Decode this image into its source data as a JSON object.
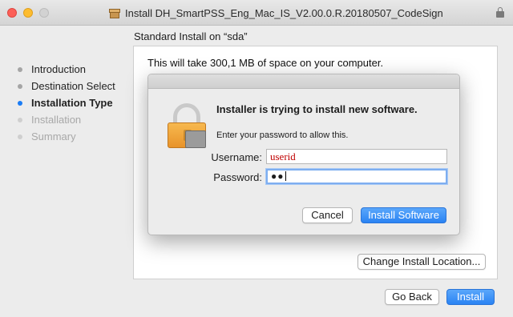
{
  "window": {
    "title": "Install DH_SmartPSS_Eng_Mac_IS_V2.00.0.R.20180507_CodeSign"
  },
  "sidebar": {
    "steps": [
      {
        "label": "Introduction",
        "state": "done"
      },
      {
        "label": "Destination Select",
        "state": "done"
      },
      {
        "label": "Installation Type",
        "state": "active"
      },
      {
        "label": "Installation",
        "state": "future"
      },
      {
        "label": "Summary",
        "state": "future"
      }
    ]
  },
  "main": {
    "section_title": "Standard Install on “sda”",
    "space_text": "This will take 300,1 MB of space on your computer.",
    "change_location_label": "Change Install Location...",
    "go_back_label": "Go Back",
    "install_label": "Install"
  },
  "dialog": {
    "title": "Installer is trying to install new software.",
    "subtitle": "Enter your password to allow this.",
    "username_label": "Username:",
    "username_value": "userid",
    "password_label": "Password:",
    "password_mask": "●●",
    "cancel_label": "Cancel",
    "install_software_label": "Install Software"
  },
  "colors": {
    "accent": "#2a83f3",
    "active_step_dot": "#1a7cf5",
    "username_text": "#c00000"
  },
  "icons": {
    "title_icon": "package-icon",
    "dialog_icon": "lock-icon",
    "titlebar_right": "lock-icon"
  }
}
